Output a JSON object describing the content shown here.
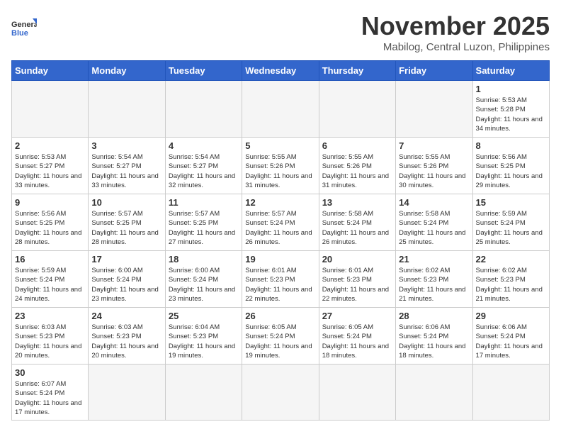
{
  "header": {
    "logo": "GeneralBlue",
    "logo_general": "General",
    "logo_blue": "Blue",
    "month_title": "November 2025",
    "location": "Mabilog, Central Luzon, Philippines"
  },
  "days_of_week": [
    "Sunday",
    "Monday",
    "Tuesday",
    "Wednesday",
    "Thursday",
    "Friday",
    "Saturday"
  ],
  "weeks": [
    [
      {
        "day": "",
        "info": ""
      },
      {
        "day": "",
        "info": ""
      },
      {
        "day": "",
        "info": ""
      },
      {
        "day": "",
        "info": ""
      },
      {
        "day": "",
        "info": ""
      },
      {
        "day": "",
        "info": ""
      },
      {
        "day": "1",
        "info": "Sunrise: 5:53 AM\nSunset: 5:28 PM\nDaylight: 11 hours\nand 34 minutes."
      }
    ],
    [
      {
        "day": "2",
        "info": "Sunrise: 5:53 AM\nSunset: 5:27 PM\nDaylight: 11 hours\nand 33 minutes."
      },
      {
        "day": "3",
        "info": "Sunrise: 5:54 AM\nSunset: 5:27 PM\nDaylight: 11 hours\nand 33 minutes."
      },
      {
        "day": "4",
        "info": "Sunrise: 5:54 AM\nSunset: 5:27 PM\nDaylight: 11 hours\nand 32 minutes."
      },
      {
        "day": "5",
        "info": "Sunrise: 5:55 AM\nSunset: 5:26 PM\nDaylight: 11 hours\nand 31 minutes."
      },
      {
        "day": "6",
        "info": "Sunrise: 5:55 AM\nSunset: 5:26 PM\nDaylight: 11 hours\nand 31 minutes."
      },
      {
        "day": "7",
        "info": "Sunrise: 5:55 AM\nSunset: 5:26 PM\nDaylight: 11 hours\nand 30 minutes."
      },
      {
        "day": "8",
        "info": "Sunrise: 5:56 AM\nSunset: 5:25 PM\nDaylight: 11 hours\nand 29 minutes."
      }
    ],
    [
      {
        "day": "9",
        "info": "Sunrise: 5:56 AM\nSunset: 5:25 PM\nDaylight: 11 hours\nand 28 minutes."
      },
      {
        "day": "10",
        "info": "Sunrise: 5:57 AM\nSunset: 5:25 PM\nDaylight: 11 hours\nand 28 minutes."
      },
      {
        "day": "11",
        "info": "Sunrise: 5:57 AM\nSunset: 5:25 PM\nDaylight: 11 hours\nand 27 minutes."
      },
      {
        "day": "12",
        "info": "Sunrise: 5:57 AM\nSunset: 5:24 PM\nDaylight: 11 hours\nand 26 minutes."
      },
      {
        "day": "13",
        "info": "Sunrise: 5:58 AM\nSunset: 5:24 PM\nDaylight: 11 hours\nand 26 minutes."
      },
      {
        "day": "14",
        "info": "Sunrise: 5:58 AM\nSunset: 5:24 PM\nDaylight: 11 hours\nand 25 minutes."
      },
      {
        "day": "15",
        "info": "Sunrise: 5:59 AM\nSunset: 5:24 PM\nDaylight: 11 hours\nand 25 minutes."
      }
    ],
    [
      {
        "day": "16",
        "info": "Sunrise: 5:59 AM\nSunset: 5:24 PM\nDaylight: 11 hours\nand 24 minutes."
      },
      {
        "day": "17",
        "info": "Sunrise: 6:00 AM\nSunset: 5:24 PM\nDaylight: 11 hours\nand 23 minutes."
      },
      {
        "day": "18",
        "info": "Sunrise: 6:00 AM\nSunset: 5:24 PM\nDaylight: 11 hours\nand 23 minutes."
      },
      {
        "day": "19",
        "info": "Sunrise: 6:01 AM\nSunset: 5:23 PM\nDaylight: 11 hours\nand 22 minutes."
      },
      {
        "day": "20",
        "info": "Sunrise: 6:01 AM\nSunset: 5:23 PM\nDaylight: 11 hours\nand 22 minutes."
      },
      {
        "day": "21",
        "info": "Sunrise: 6:02 AM\nSunset: 5:23 PM\nDaylight: 11 hours\nand 21 minutes."
      },
      {
        "day": "22",
        "info": "Sunrise: 6:02 AM\nSunset: 5:23 PM\nDaylight: 11 hours\nand 21 minutes."
      }
    ],
    [
      {
        "day": "23",
        "info": "Sunrise: 6:03 AM\nSunset: 5:23 PM\nDaylight: 11 hours\nand 20 minutes."
      },
      {
        "day": "24",
        "info": "Sunrise: 6:03 AM\nSunset: 5:23 PM\nDaylight: 11 hours\nand 20 minutes."
      },
      {
        "day": "25",
        "info": "Sunrise: 6:04 AM\nSunset: 5:23 PM\nDaylight: 11 hours\nand 19 minutes."
      },
      {
        "day": "26",
        "info": "Sunrise: 6:05 AM\nSunset: 5:24 PM\nDaylight: 11 hours\nand 19 minutes."
      },
      {
        "day": "27",
        "info": "Sunrise: 6:05 AM\nSunset: 5:24 PM\nDaylight: 11 hours\nand 18 minutes."
      },
      {
        "day": "28",
        "info": "Sunrise: 6:06 AM\nSunset: 5:24 PM\nDaylight: 11 hours\nand 18 minutes."
      },
      {
        "day": "29",
        "info": "Sunrise: 6:06 AM\nSunset: 5:24 PM\nDaylight: 11 hours\nand 17 minutes."
      }
    ],
    [
      {
        "day": "30",
        "info": "Sunrise: 6:07 AM\nSunset: 5:24 PM\nDaylight: 11 hours\nand 17 minutes."
      },
      {
        "day": "",
        "info": ""
      },
      {
        "day": "",
        "info": ""
      },
      {
        "day": "",
        "info": ""
      },
      {
        "day": "",
        "info": ""
      },
      {
        "day": "",
        "info": ""
      },
      {
        "day": "",
        "info": ""
      }
    ]
  ]
}
